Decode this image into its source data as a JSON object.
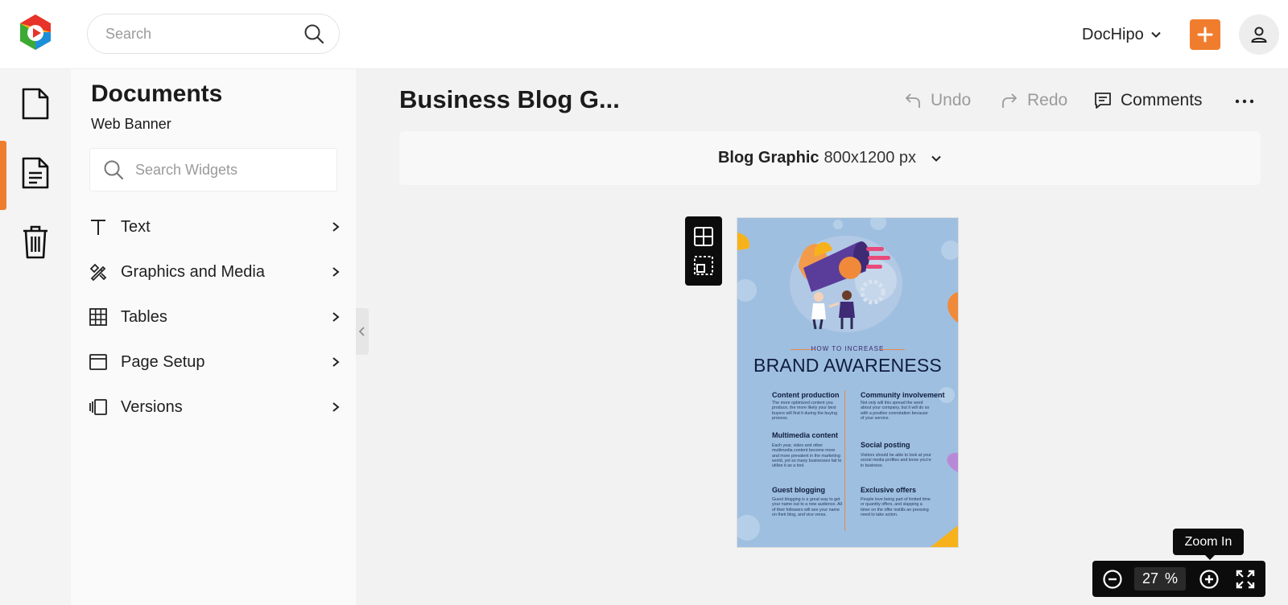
{
  "app": {
    "search_placeholder": "Search",
    "account_name": "DocHipo",
    "brand_colors": {
      "accent": "#f07d2e",
      "logo_red": "#e7332a",
      "logo_green": "#3aaa35",
      "logo_yellow": "#f7b21b",
      "logo_blue": "#1d8fd8"
    }
  },
  "rail": {
    "items": [
      {
        "name": "documents",
        "icon": "document-icon"
      },
      {
        "name": "templates",
        "icon": "text-document-icon",
        "active": true
      },
      {
        "name": "trash",
        "icon": "trash-icon"
      }
    ]
  },
  "panel": {
    "title": "Documents",
    "subtitle": "Web Banner",
    "search_placeholder": "Search Widgets",
    "items": [
      {
        "label": "Text",
        "icon": "text-icon"
      },
      {
        "label": "Graphics and Media",
        "icon": "graphics-icon"
      },
      {
        "label": "Tables",
        "icon": "table-icon"
      },
      {
        "label": "Page Setup",
        "icon": "page-setup-icon"
      },
      {
        "label": "Versions",
        "icon": "versions-icon"
      }
    ]
  },
  "editor": {
    "doc_title": "Business Blog G...",
    "undo_label": "Undo",
    "redo_label": "Redo",
    "comments_label": "Comments",
    "format_name": "Blog Graphic",
    "format_size": "800x1200 px"
  },
  "canvas": {
    "kicker": "HOW TO INCREASE",
    "heading": "BRAND AWARENESS",
    "sections": [
      {
        "title": "Content production",
        "body": "The more optimized content you produce, the more likely your best buyers will find it during the buying process."
      },
      {
        "title": "Community involvement",
        "body": "Not only will this spread the word about your company, but it will do so with a positive connotation because of your service."
      },
      {
        "title": "Multimedia content",
        "body": "Each year, video and other multimedia content become more and more prevalent in the marketing world, yet so many businesses fail to utilize it as a tool."
      },
      {
        "title": "Social posting",
        "body": "Visitors should be able to look at your social media profiles and know you're in business."
      },
      {
        "title": "Guest blogging",
        "body": "Guest blogging is a great way to get your name out to a new audience. All of their followers will see your name on their blog, and vice versa."
      },
      {
        "title": "Exclusive offers",
        "body": "People love being part of limited time or quantity offers, and slapping a timer on the offer instills an pressing need to take action."
      }
    ],
    "page_color": "#9fbfe0"
  },
  "zoom": {
    "tooltip": "Zoom In",
    "value": "27",
    "unit": "%"
  }
}
